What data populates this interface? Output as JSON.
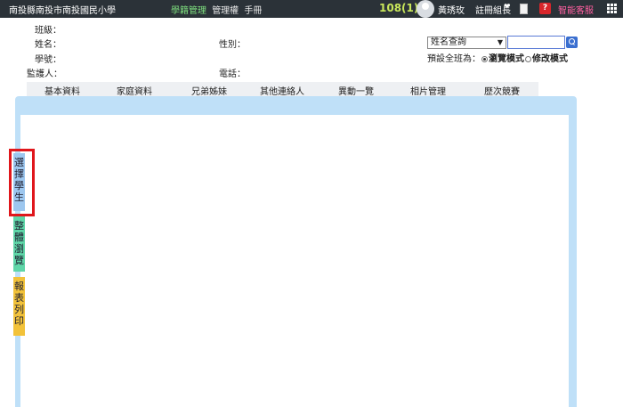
{
  "topbar": {
    "school": "南投縣南投市南投國民小學",
    "nav": [
      "學籍管理",
      "管理權",
      "手冊"
    ],
    "year": "108(1)",
    "user": "黃琇玫",
    "role": "註冊組長",
    "service": "智能客服",
    "help_label": "?"
  },
  "student": {
    "class_label": "班級：",
    "name_label": "姓名：",
    "gender_label": "性別：",
    "id_label": "學號：",
    "guardian_label": "監護人：",
    "phone_label": "電話："
  },
  "search": {
    "select_value": "姓名查詢",
    "input_value": "",
    "default_label": "預設全班為：",
    "browse_mode": "瀏覽模式",
    "edit_mode": "修改模式",
    "selected_mode": "browse"
  },
  "tabs": [
    "基本資料",
    "家庭資料",
    "兄弟姊妹",
    "其他連絡人",
    "異動一覽",
    "相片管理",
    "歷次競賽"
  ],
  "side_tabs": {
    "select_student": [
      "選",
      "擇",
      "學",
      "生"
    ],
    "overall_browse": [
      "整",
      "體",
      "瀏",
      "覽"
    ],
    "report_print": [
      "報",
      "表",
      "列",
      "印"
    ]
  },
  "colors": {
    "topbar": "#2b3238",
    "panel": "#bfe0f8",
    "side_select": "#9dc7ef",
    "side_overall": "#5fd6a8",
    "side_print": "#f2c23a",
    "highlight": "#e0171c"
  }
}
